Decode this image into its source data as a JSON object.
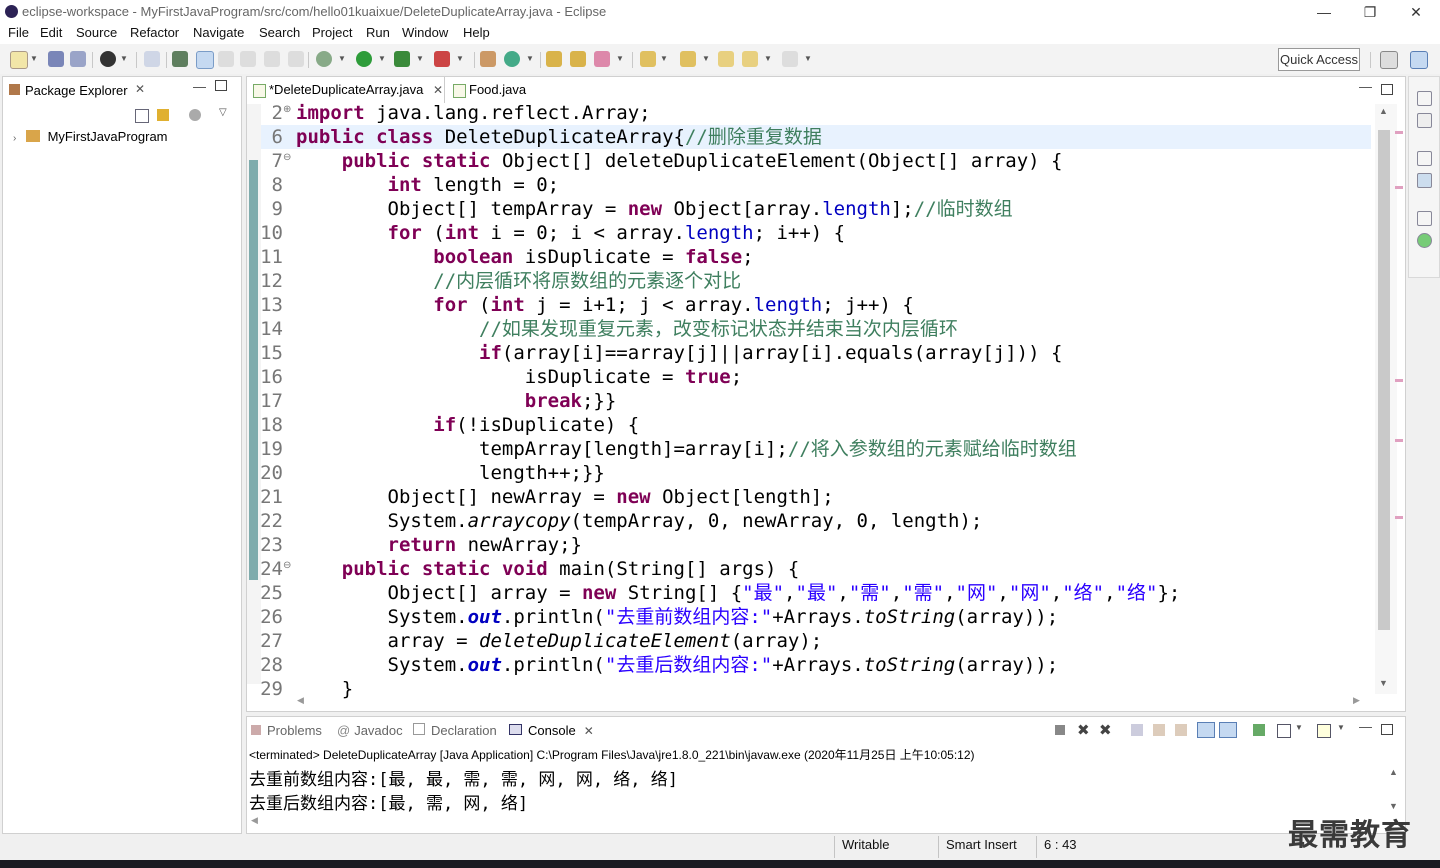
{
  "window": {
    "title": "eclipse-workspace - MyFirstJavaProgram/src/com/hello01kuaixue/DeleteDuplicateArray.java - Eclipse",
    "minimize": "—",
    "restore": "❐",
    "close": "✕"
  },
  "menu": [
    "File",
    "Edit",
    "Source",
    "Refactor",
    "Navigate",
    "Search",
    "Project",
    "Run",
    "Window",
    "Help"
  ],
  "toolbar": {
    "quick_access": "Quick Access"
  },
  "package_explorer": {
    "title": "Package Explorer",
    "close": "✕",
    "project": "MyFirstJavaProgram"
  },
  "editor": {
    "tabs": [
      {
        "label": "*DeleteDuplicateArray.java",
        "close": "✕"
      },
      {
        "label": "Food.java",
        "close": ""
      }
    ],
    "lines": [
      {
        "num": "2",
        "fold": "⊕",
        "segments": [
          {
            "t": "import",
            "c": "kw"
          },
          {
            "t": " java.lang.reflect.Array;",
            "c": ""
          }
        ]
      },
      {
        "num": "6",
        "fold": "",
        "segments": [
          {
            "t": "public",
            "c": "kw"
          },
          {
            "t": " ",
            "c": ""
          },
          {
            "t": "class",
            "c": "kw"
          },
          {
            "t": " DeleteDuplicateArray{",
            "c": ""
          },
          {
            "t": "//删除重复数据",
            "c": "cm"
          }
        ]
      },
      {
        "num": "7",
        "fold": "⊖",
        "segments": [
          {
            "t": "    ",
            "c": ""
          },
          {
            "t": "public",
            "c": "kw"
          },
          {
            "t": " ",
            "c": ""
          },
          {
            "t": "static",
            "c": "kw"
          },
          {
            "t": " Object[] deleteDuplicateElement(Object[] array) {",
            "c": ""
          }
        ]
      },
      {
        "num": "8",
        "fold": "",
        "segments": [
          {
            "t": "        ",
            "c": ""
          },
          {
            "t": "int",
            "c": "kw"
          },
          {
            "t": " length = 0;",
            "c": ""
          }
        ]
      },
      {
        "num": "9",
        "fold": "",
        "segments": [
          {
            "t": "        Object[] tempArray = ",
            "c": ""
          },
          {
            "t": "new",
            "c": "kw"
          },
          {
            "t": " Object[array.",
            "c": ""
          },
          {
            "t": "length",
            "c": "fd"
          },
          {
            "t": "];",
            "c": ""
          },
          {
            "t": "//临时数组",
            "c": "cm"
          }
        ]
      },
      {
        "num": "10",
        "fold": "",
        "segments": [
          {
            "t": "        ",
            "c": ""
          },
          {
            "t": "for",
            "c": "kw"
          },
          {
            "t": " (",
            "c": ""
          },
          {
            "t": "int",
            "c": "kw"
          },
          {
            "t": " i = 0; i < array.",
            "c": ""
          },
          {
            "t": "length",
            "c": "fd"
          },
          {
            "t": "; i++) {",
            "c": ""
          }
        ]
      },
      {
        "num": "11",
        "fold": "",
        "segments": [
          {
            "t": "            ",
            "c": ""
          },
          {
            "t": "boolean",
            "c": "kw"
          },
          {
            "t": " isDuplicate = ",
            "c": ""
          },
          {
            "t": "false",
            "c": "kw"
          },
          {
            "t": ";",
            "c": ""
          }
        ]
      },
      {
        "num": "12",
        "fold": "",
        "segments": [
          {
            "t": "            ",
            "c": ""
          },
          {
            "t": "//内层循环将原数组的元素逐个对比",
            "c": "cm"
          }
        ]
      },
      {
        "num": "13",
        "fold": "",
        "segments": [
          {
            "t": "            ",
            "c": ""
          },
          {
            "t": "for",
            "c": "kw"
          },
          {
            "t": " (",
            "c": ""
          },
          {
            "t": "int",
            "c": "kw"
          },
          {
            "t": " j = i+1; j < array.",
            "c": ""
          },
          {
            "t": "length",
            "c": "fd"
          },
          {
            "t": "; j++) {",
            "c": ""
          }
        ]
      },
      {
        "num": "14",
        "fold": "",
        "segments": [
          {
            "t": "                ",
            "c": ""
          },
          {
            "t": "//如果发现重复元素，改变标记状态并结束当次内层循环",
            "c": "cm"
          }
        ]
      },
      {
        "num": "15",
        "fold": "",
        "segments": [
          {
            "t": "                ",
            "c": ""
          },
          {
            "t": "if",
            "c": "kw"
          },
          {
            "t": "(array[i]==array[j]||array[i].equals(array[j])) {",
            "c": ""
          }
        ]
      },
      {
        "num": "16",
        "fold": "",
        "segments": [
          {
            "t": "                    isDuplicate = ",
            "c": ""
          },
          {
            "t": "true",
            "c": "kw"
          },
          {
            "t": ";",
            "c": ""
          }
        ]
      },
      {
        "num": "17",
        "fold": "",
        "segments": [
          {
            "t": "                    ",
            "c": ""
          },
          {
            "t": "break",
            "c": "kw"
          },
          {
            "t": ";}}",
            "c": ""
          }
        ]
      },
      {
        "num": "18",
        "fold": "",
        "segments": [
          {
            "t": "            ",
            "c": ""
          },
          {
            "t": "if",
            "c": "kw"
          },
          {
            "t": "(!isDuplicate) {",
            "c": ""
          }
        ]
      },
      {
        "num": "19",
        "fold": "",
        "segments": [
          {
            "t": "                tempArray[length]=array[i];",
            "c": ""
          },
          {
            "t": "//将入参数组的元素赋给临时数组",
            "c": "cm"
          }
        ]
      },
      {
        "num": "20",
        "fold": "",
        "segments": [
          {
            "t": "                length++;}}",
            "c": ""
          }
        ]
      },
      {
        "num": "21",
        "fold": "",
        "segments": [
          {
            "t": "        Object[] newArray = ",
            "c": ""
          },
          {
            "t": "new",
            "c": "kw"
          },
          {
            "t": " Object[length];",
            "c": ""
          }
        ]
      },
      {
        "num": "22",
        "fold": "",
        "segments": [
          {
            "t": "        System.",
            "c": ""
          },
          {
            "t": "arraycopy",
            "c": "it"
          },
          {
            "t": "(tempArray, 0, newArray, 0, length);",
            "c": ""
          }
        ]
      },
      {
        "num": "23",
        "fold": "",
        "segments": [
          {
            "t": "        ",
            "c": ""
          },
          {
            "t": "return",
            "c": "kw"
          },
          {
            "t": " newArray;}",
            "c": ""
          }
        ]
      },
      {
        "num": "24",
        "fold": "⊖",
        "segments": [
          {
            "t": "    ",
            "c": ""
          },
          {
            "t": "public",
            "c": "kw"
          },
          {
            "t": " ",
            "c": ""
          },
          {
            "t": "static",
            "c": "kw"
          },
          {
            "t": " ",
            "c": ""
          },
          {
            "t": "void",
            "c": "kw"
          },
          {
            "t": " main(String[] args) {",
            "c": ""
          }
        ]
      },
      {
        "num": "25",
        "fold": "",
        "segments": [
          {
            "t": "        Object[] array = ",
            "c": ""
          },
          {
            "t": "new",
            "c": "kw"
          },
          {
            "t": " String[] {",
            "c": ""
          },
          {
            "t": "\"最\"",
            "c": "st"
          },
          {
            "t": ",",
            "c": ""
          },
          {
            "t": "\"最\"",
            "c": "st"
          },
          {
            "t": ",",
            "c": ""
          },
          {
            "t": "\"需\"",
            "c": "st"
          },
          {
            "t": ",",
            "c": ""
          },
          {
            "t": "\"需\"",
            "c": "st"
          },
          {
            "t": ",",
            "c": ""
          },
          {
            "t": "\"网\"",
            "c": "st"
          },
          {
            "t": ",",
            "c": ""
          },
          {
            "t": "\"网\"",
            "c": "st"
          },
          {
            "t": ",",
            "c": ""
          },
          {
            "t": "\"络\"",
            "c": "st"
          },
          {
            "t": ",",
            "c": ""
          },
          {
            "t": "\"络\"",
            "c": "st"
          },
          {
            "t": "};",
            "c": ""
          }
        ]
      },
      {
        "num": "26",
        "fold": "",
        "segments": [
          {
            "t": "        System.",
            "c": ""
          },
          {
            "t": "out",
            "c": "fdi"
          },
          {
            "t": ".println(",
            "c": ""
          },
          {
            "t": "\"去重前数组内容:\"",
            "c": "st"
          },
          {
            "t": "+Arrays.",
            "c": ""
          },
          {
            "t": "toString",
            "c": "it"
          },
          {
            "t": "(array));",
            "c": ""
          }
        ]
      },
      {
        "num": "27",
        "fold": "",
        "segments": [
          {
            "t": "        array = ",
            "c": ""
          },
          {
            "t": "deleteDuplicateElement",
            "c": "it"
          },
          {
            "t": "(array);",
            "c": ""
          }
        ]
      },
      {
        "num": "28",
        "fold": "",
        "segments": [
          {
            "t": "        System.",
            "c": ""
          },
          {
            "t": "out",
            "c": "fdi"
          },
          {
            "t": ".println(",
            "c": ""
          },
          {
            "t": "\"去重后数组内容:\"",
            "c": "st"
          },
          {
            "t": "+Arrays.",
            "c": ""
          },
          {
            "t": "toString",
            "c": "it"
          },
          {
            "t": "(array));",
            "c": ""
          }
        ]
      },
      {
        "num": "29",
        "fold": "",
        "segments": [
          {
            "t": "    }",
            "c": ""
          }
        ]
      }
    ]
  },
  "console": {
    "tabs": [
      "Problems",
      "Javadoc",
      "Declaration",
      "Console"
    ],
    "active_tab": "Console",
    "info": "<terminated> DeleteDuplicateArray [Java Application] C:\\Program Files\\Java\\jre1.8.0_221\\bin\\javaw.exe (2020年11月25日 上午10:05:12)",
    "output": [
      "去重前数组内容:[最, 最, 需, 需, 网, 网, 络, 络]",
      "去重后数组内容:[最, 需, 网, 络]"
    ]
  },
  "status": {
    "writable": "Writable",
    "insert_mode": "Smart Insert",
    "position": "6 : 43"
  },
  "watermark": "最需教育"
}
